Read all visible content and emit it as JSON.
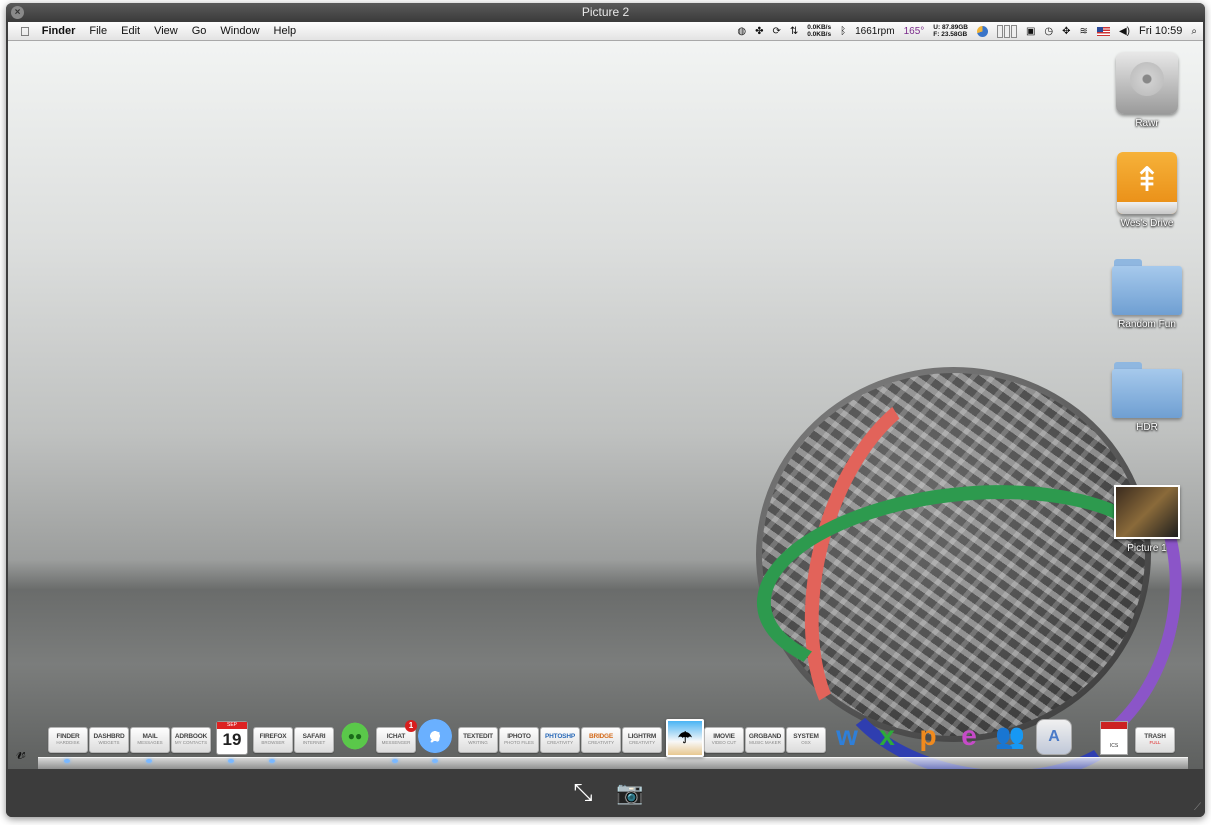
{
  "window": {
    "title": "Picture 2"
  },
  "menubar": {
    "apple": "",
    "items": [
      "Finder",
      "File",
      "Edit",
      "View",
      "Go",
      "Window",
      "Help"
    ],
    "net_up": "0.0KB/s",
    "net_down": "0.0KB/s",
    "fan": "1661rpm",
    "temp": "165°",
    "disk_used_label": "U:",
    "disk_free_label": "F:",
    "disk_used": "87.89GB",
    "disk_free": "23.58GB",
    "clock": "Fri 10:59"
  },
  "desktop_icons": [
    {
      "label": "Rawr"
    },
    {
      "label": "Wes's Drive"
    },
    {
      "label": "Random Fun"
    },
    {
      "label": "HDR"
    },
    {
      "label": "Picture 1"
    }
  ],
  "dock": {
    "finder": {
      "name": "FINDER",
      "sub": "HARDDISK"
    },
    "dashboard": {
      "name": "DASHBRD",
      "sub": "WIDGETS"
    },
    "mail": {
      "name": "MAIL",
      "sub": "MESSAGES"
    },
    "addressbook": {
      "name": "ADRBOOK",
      "sub": "MY CONTACTS"
    },
    "calendar": {
      "month": "SEP",
      "day": "19"
    },
    "firefox": {
      "name": "FIREFOX",
      "sub": "BROWSER"
    },
    "safari": {
      "name": "SAFARI",
      "sub": "INTERNET"
    },
    "ichat": {
      "name": "ICHAT",
      "sub": "MESSENGER",
      "badge": "1"
    },
    "textedit": {
      "name": "TEXTEDIT",
      "sub": "WRITING"
    },
    "iphoto": {
      "name": "IPHOTO",
      "sub": "PHOTO FILES"
    },
    "photoshop": {
      "name": "PHTOSHP",
      "sub": "CREATIVITY"
    },
    "bridge": {
      "name": "BRIDGE",
      "sub": "CREATIVITY"
    },
    "lightroom": {
      "name": "LIGHTRM",
      "sub": "CREATIVITY"
    },
    "imovie": {
      "name": "IMOVIE",
      "sub": "VIDEO CUT"
    },
    "garageband": {
      "name": "GRGBAND",
      "sub": "MUSIC MAKER"
    },
    "system": {
      "name": "SYSTEM",
      "sub": "OSX"
    },
    "ics_label": "ICS",
    "trash": {
      "name": "TRASH",
      "sub": "FULL"
    }
  },
  "colors": {
    "accent_blue": "#2a6ab8",
    "dock_dot": "#7ab8ff",
    "badge_red": "#d81e1e"
  }
}
